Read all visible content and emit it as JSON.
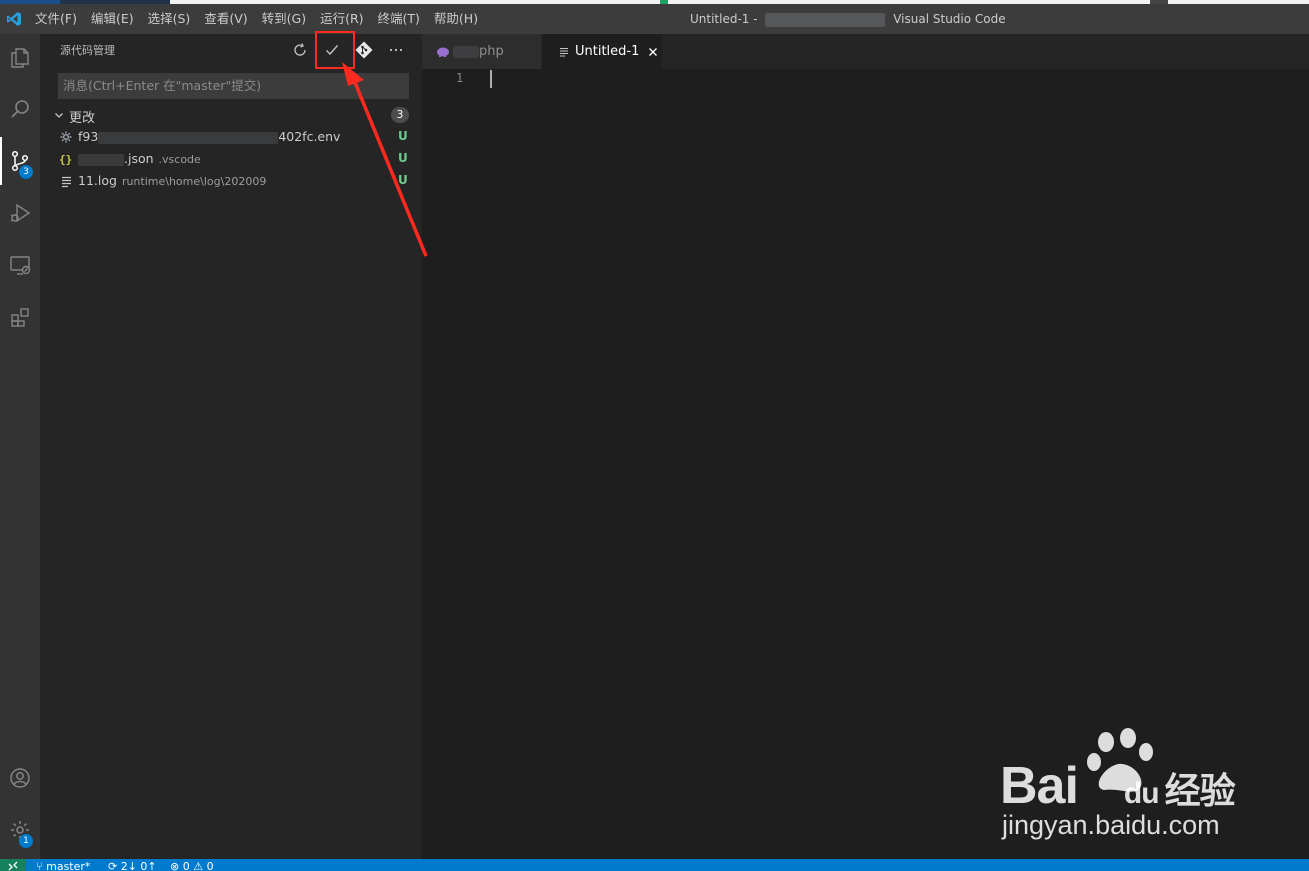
{
  "titlebar": {
    "menu": [
      "文件(F)",
      "编辑(E)",
      "选择(S)",
      "查看(V)",
      "转到(G)",
      "运行(R)",
      "终端(T)",
      "帮助(H)"
    ],
    "title_left": "Untitled-1 -",
    "title_right": "Visual Studio Code"
  },
  "activitybar": {
    "icons": [
      "files-icon",
      "search-icon",
      "source-control-icon",
      "run-debug-icon",
      "remote-explorer-icon",
      "extensions-icon",
      "account-icon",
      "settings-gear-icon"
    ],
    "source_control_badge": "3",
    "settings_badge": "1"
  },
  "sidebar": {
    "title": "源代码管理",
    "commit_placeholder": "消息(Ctrl+Enter 在\"master\"提交)",
    "group_label": "更改",
    "group_count": "3",
    "files": [
      {
        "name_prefix": "f93",
        "name_suffix": "402fc.env",
        "desc": "",
        "status": "U",
        "icon": "gear-icon"
      },
      {
        "name_prefix": "",
        "name_suffix": ".json",
        "desc": ".vscode",
        "status": "U",
        "icon": "json-braces-icon"
      },
      {
        "name_prefix": "11.log",
        "name_suffix": "",
        "desc": "runtime\\home\\log\\202009",
        "status": "U",
        "icon": "text-lines-icon"
      }
    ]
  },
  "tabs": [
    {
      "label": "php",
      "active": false,
      "icon": "php-elephant-icon"
    },
    {
      "label": "Untitled-1",
      "active": true,
      "icon": "text-lines-icon"
    }
  ],
  "editor": {
    "line_numbers": [
      "1"
    ]
  },
  "statusbar": {
    "branch": "master*",
    "sync": "2↓ 0↑",
    "problems": "⊗ 0 ⚠ 0"
  },
  "watermark": {
    "brand": "Bai",
    "brand_suffix": "du",
    "brand_cn": "经验",
    "url": "jingyan.baidu.com"
  },
  "colors": {
    "accent": "#007acc",
    "untracked": "#73c991",
    "annotation": "#ff2a1f"
  }
}
